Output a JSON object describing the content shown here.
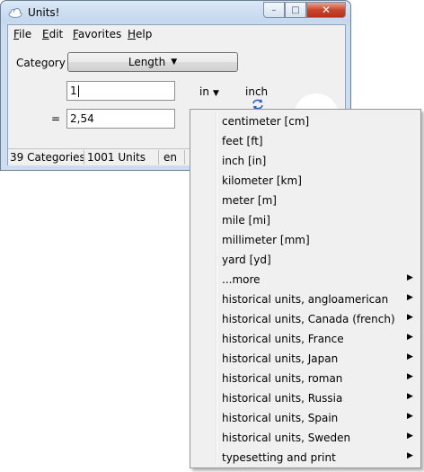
{
  "window": {
    "title": "Units!",
    "icon": "cloud-app-icon"
  },
  "caption_buttons": {
    "minimize": "–",
    "maximize": "□",
    "close": "✕"
  },
  "menu": [
    {
      "label": "File",
      "accel": "F",
      "rest": "ile"
    },
    {
      "label": "Edit",
      "accel": "E",
      "rest": "dit"
    },
    {
      "label": "Favorites",
      "accel": "F",
      "rest": "avorites"
    },
    {
      "label": "Help",
      "accel": "H",
      "rest": "elp"
    }
  ],
  "category": {
    "label": "Category",
    "value": "Length",
    "caret": "▼"
  },
  "conversion": {
    "from_value": "1",
    "equals": "=",
    "to_value": "2,54",
    "from_unit_abbr": "in",
    "from_unit_caret": "▼",
    "from_unit_name": "inch",
    "swap_icon": "swap-arrows-icon"
  },
  "status": {
    "categories": "39 Categories",
    "units": "1001 Units",
    "lang": "en"
  },
  "unit_menu": {
    "items": [
      {
        "label": "centimeter [cm]",
        "submenu": false
      },
      {
        "label": "feet [ft]",
        "submenu": false
      },
      {
        "label": "inch [in]",
        "submenu": false
      },
      {
        "label": "kilometer [km]",
        "submenu": false
      },
      {
        "label": "meter [m]",
        "submenu": false
      },
      {
        "label": "mile [mi]",
        "submenu": false
      },
      {
        "label": "millimeter [mm]",
        "submenu": false
      },
      {
        "label": "yard [yd]",
        "submenu": false
      },
      {
        "label": "...more",
        "submenu": true
      },
      {
        "label": "historical units, angloamerican",
        "submenu": true
      },
      {
        "label": "historical units, Canada (french)",
        "submenu": true
      },
      {
        "label": "historical units, France",
        "submenu": true
      },
      {
        "label": "historical units, Japan",
        "submenu": true
      },
      {
        "label": "historical units, roman",
        "submenu": true
      },
      {
        "label": "historical units, Russia",
        "submenu": true
      },
      {
        "label": "historical units, Spain",
        "submenu": true
      },
      {
        "label": "historical units, Sweden",
        "submenu": true
      },
      {
        "label": "typesetting and print",
        "submenu": true
      }
    ],
    "submenu_arrow": "▶"
  },
  "colors": {
    "close_button": "#c9462c",
    "title_gradient": "#c5d8ee",
    "menu_bg": "#f0f0f0"
  }
}
